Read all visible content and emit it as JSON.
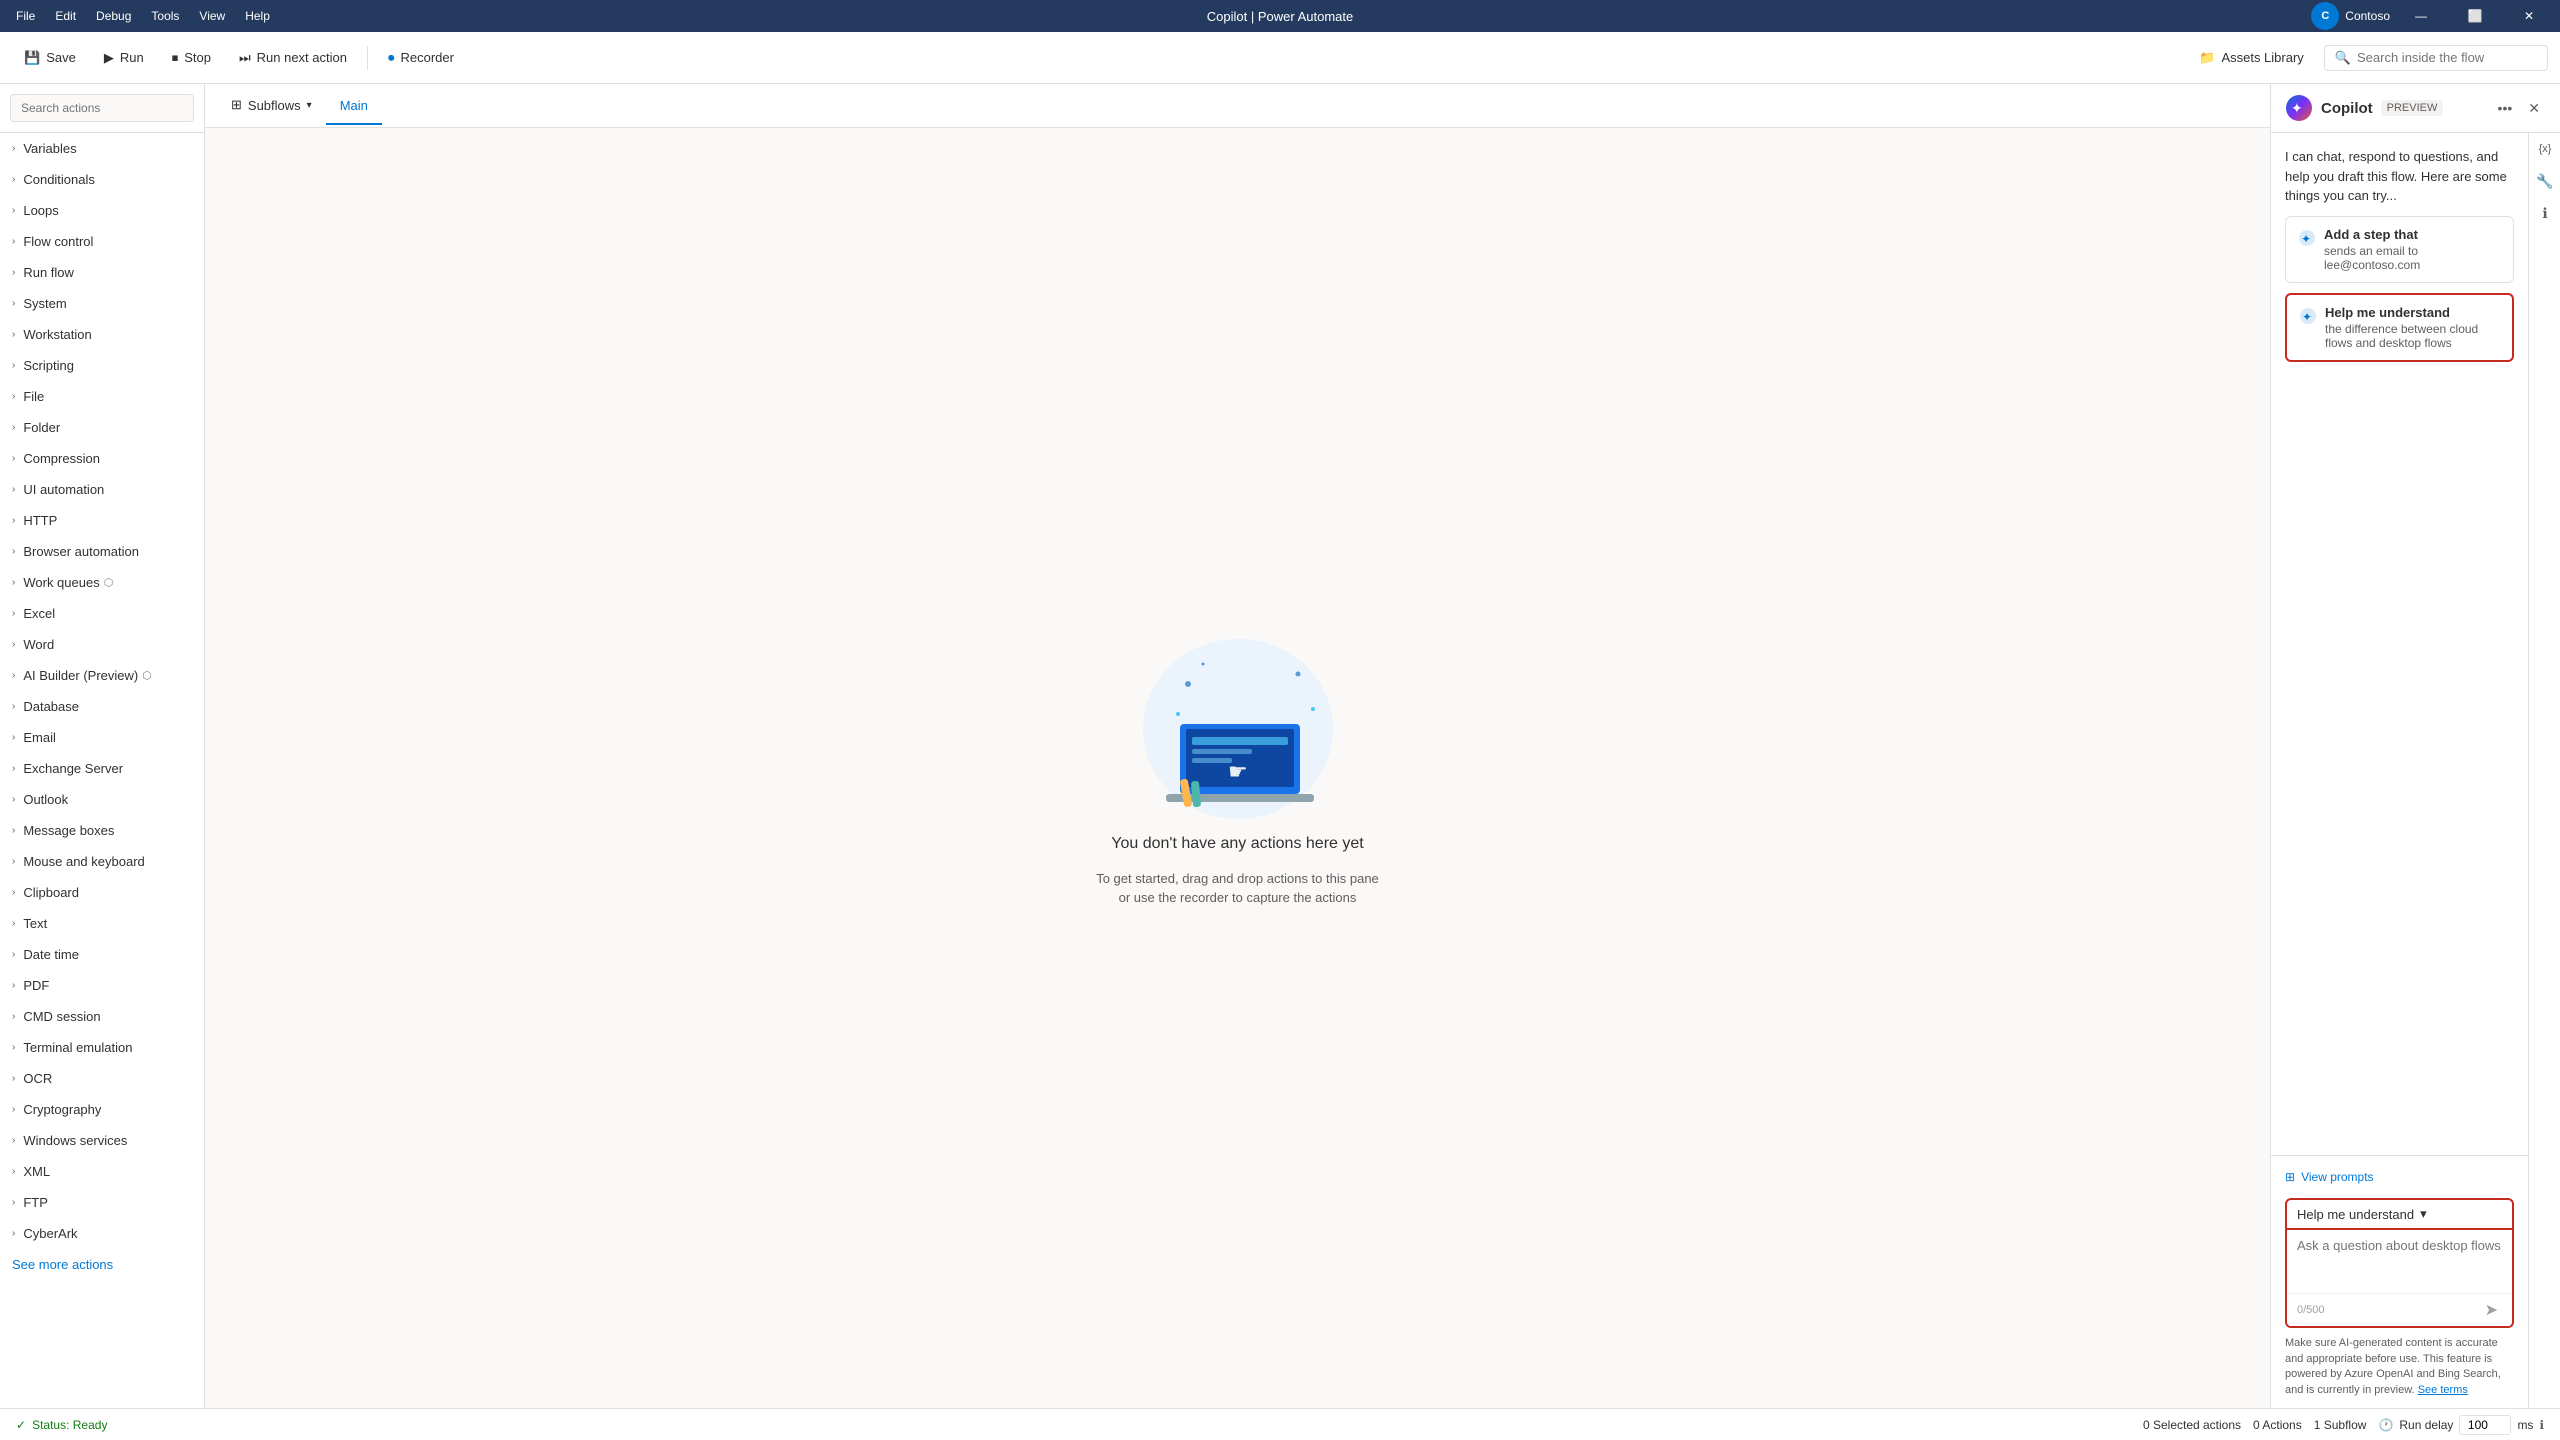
{
  "titlebar": {
    "menus": [
      "File",
      "Edit",
      "Debug",
      "Tools",
      "View",
      "Help"
    ],
    "title": "Copilot | Power Automate",
    "user": "Contoso",
    "btns": [
      "—",
      "⬜",
      "✕"
    ]
  },
  "toolbar": {
    "save_label": "Save",
    "run_label": "Run",
    "stop_label": "Stop",
    "next_label": "Run next action",
    "recorder_label": "Recorder",
    "assets_label": "Assets Library",
    "search_placeholder": "Search inside the flow"
  },
  "tabs": {
    "subflows_label": "Subflows",
    "main_label": "Main"
  },
  "sidebar": {
    "search_placeholder": "Search actions",
    "items": [
      {
        "label": "Variables"
      },
      {
        "label": "Conditionals"
      },
      {
        "label": "Loops"
      },
      {
        "label": "Flow control"
      },
      {
        "label": "Run flow"
      },
      {
        "label": "System"
      },
      {
        "label": "Workstation"
      },
      {
        "label": "Scripting"
      },
      {
        "label": "File"
      },
      {
        "label": "Folder"
      },
      {
        "label": "Compression"
      },
      {
        "label": "UI automation"
      },
      {
        "label": "HTTP"
      },
      {
        "label": "Browser automation"
      },
      {
        "label": "Work queues",
        "premium": true
      },
      {
        "label": "Excel"
      },
      {
        "label": "Word"
      },
      {
        "label": "AI Builder (Preview)",
        "premium": true
      },
      {
        "label": "Database"
      },
      {
        "label": "Email"
      },
      {
        "label": "Exchange Server"
      },
      {
        "label": "Outlook"
      },
      {
        "label": "Message boxes"
      },
      {
        "label": "Mouse and keyboard"
      },
      {
        "label": "Clipboard"
      },
      {
        "label": "Text"
      },
      {
        "label": "Date time"
      },
      {
        "label": "PDF"
      },
      {
        "label": "CMD session"
      },
      {
        "label": "Terminal emulation"
      },
      {
        "label": "OCR"
      },
      {
        "label": "Cryptography"
      },
      {
        "label": "Windows services"
      },
      {
        "label": "XML"
      },
      {
        "label": "FTP"
      },
      {
        "label": "CyberArk"
      }
    ],
    "see_more": "See more actions"
  },
  "canvas": {
    "empty_title": "You don't have any actions here yet",
    "empty_sub_line1": "To get started, drag and drop actions to this pane",
    "empty_sub_line2": "or use the recorder to capture the actions"
  },
  "copilot": {
    "title": "Copilot",
    "preview_label": "PREVIEW",
    "intro": "I can chat, respond to questions, and help you draft this flow. Here are some things you can try...",
    "suggestions": [
      {
        "title": "Add a step that",
        "sub": "sends an email to lee@contoso.com"
      },
      {
        "title": "Help me understand",
        "sub": "the difference between cloud flows and desktop flows",
        "selected": true
      }
    ],
    "view_prompts_label": "View prompts",
    "mode_label": "Help me understand",
    "input_placeholder": "Ask a question about desktop flows",
    "char_count": "0/500",
    "disclaimer": "Make sure AI-generated content is accurate and appropriate before use. This feature is powered by Azure OpenAI and Bing Search, and is currently in preview.",
    "disclaimer_link": "See terms"
  },
  "statusbar": {
    "status_label": "Status: Ready",
    "selected_actions": "0 Selected actions",
    "actions": "0 Actions",
    "subflow": "1 Subflow",
    "run_delay_label": "Run delay",
    "run_delay_value": "100",
    "run_delay_unit": "ms"
  }
}
